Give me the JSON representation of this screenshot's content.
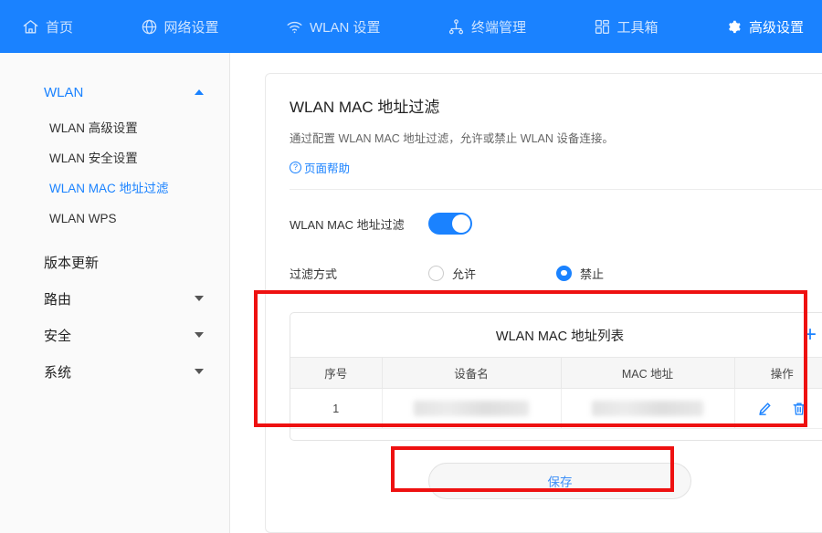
{
  "topnav": {
    "items": [
      {
        "label": "首页",
        "icon": "home-icon",
        "active": false
      },
      {
        "label": "网络设置",
        "icon": "globe-icon",
        "active": false
      },
      {
        "label": "WLAN 设置",
        "icon": "wifi-icon",
        "active": false
      },
      {
        "label": "终端管理",
        "icon": "sitemap-icon",
        "active": false
      },
      {
        "label": "工具箱",
        "icon": "grid-icon",
        "active": false
      },
      {
        "label": "高级设置",
        "icon": "gear-icon",
        "active": true
      }
    ]
  },
  "sidebar": {
    "groups": [
      {
        "label": "WLAN",
        "active": true,
        "expanded": true,
        "caret": "up",
        "items": [
          {
            "label": "WLAN 高级设置",
            "active": false
          },
          {
            "label": "WLAN 安全设置",
            "active": false
          },
          {
            "label": "WLAN MAC 地址过滤",
            "active": true
          },
          {
            "label": "WLAN WPS",
            "active": false
          }
        ]
      },
      {
        "label": "版本更新",
        "active": false,
        "expanded": false,
        "caret": "none",
        "items": []
      },
      {
        "label": "路由",
        "active": false,
        "expanded": false,
        "caret": "down",
        "items": []
      },
      {
        "label": "安全",
        "active": false,
        "expanded": false,
        "caret": "down",
        "items": []
      },
      {
        "label": "系统",
        "active": false,
        "expanded": false,
        "caret": "down",
        "items": []
      }
    ]
  },
  "main": {
    "title": "WLAN MAC 地址过滤",
    "description": "通过配置 WLAN MAC 地址过滤，允许或禁止 WLAN 设备连接。",
    "help_label": "页面帮助",
    "help_icon": "question-circle-icon",
    "filter_switch": {
      "label": "WLAN MAC 地址过滤",
      "state": "on"
    },
    "filter_mode": {
      "label": "过滤方式",
      "options": [
        {
          "label": "允许",
          "selected": false
        },
        {
          "label": "禁止",
          "selected": true
        }
      ]
    },
    "list_panel": {
      "title": "WLAN MAC 地址列表",
      "add_icon": "plus-icon",
      "columns": [
        "序号",
        "设备名",
        "MAC 地址",
        "操作"
      ],
      "rows": [
        {
          "index": "1",
          "device_name": "",
          "mac_address": "",
          "actions": [
            "edit-icon",
            "delete-icon"
          ]
        }
      ]
    },
    "save_label": "保存"
  },
  "colors": {
    "brand_blue": "#1a82ff",
    "nav_inactive": "#cfe4ff",
    "annotation_red": "#ee1111",
    "sidebar_bg": "#fafafa",
    "table_header_bg": "#f6f6f6"
  }
}
